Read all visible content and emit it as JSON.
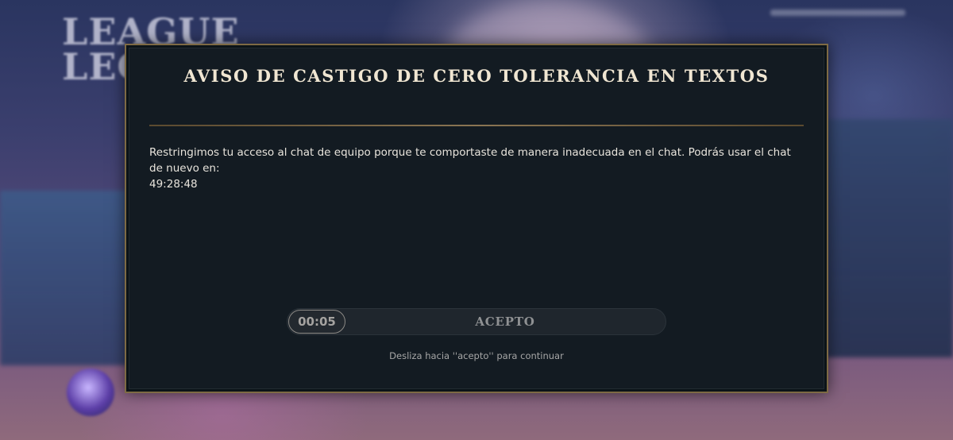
{
  "background": {
    "logo_line1": "LEAGUE",
    "logo_line2": "LEG"
  },
  "modal": {
    "title": "AVISO DE CASTIGO DE CERO TOLERANCIA EN TEXTOS",
    "message": "Restringimos tu acceso al chat de equipo porque te comportaste de manera inadecuada en el chat. Podrás usar el chat de nuevo en:",
    "countdown": "49:28:48",
    "slider": {
      "timer": "00:05",
      "label": "ACEPTO"
    },
    "hint": "Desliza hacia ''acepto'' para continuar"
  },
  "colors": {
    "frame_gold": "#7e6a44",
    "modal_bg": "#131b22",
    "title_text": "#f0e6d2"
  }
}
